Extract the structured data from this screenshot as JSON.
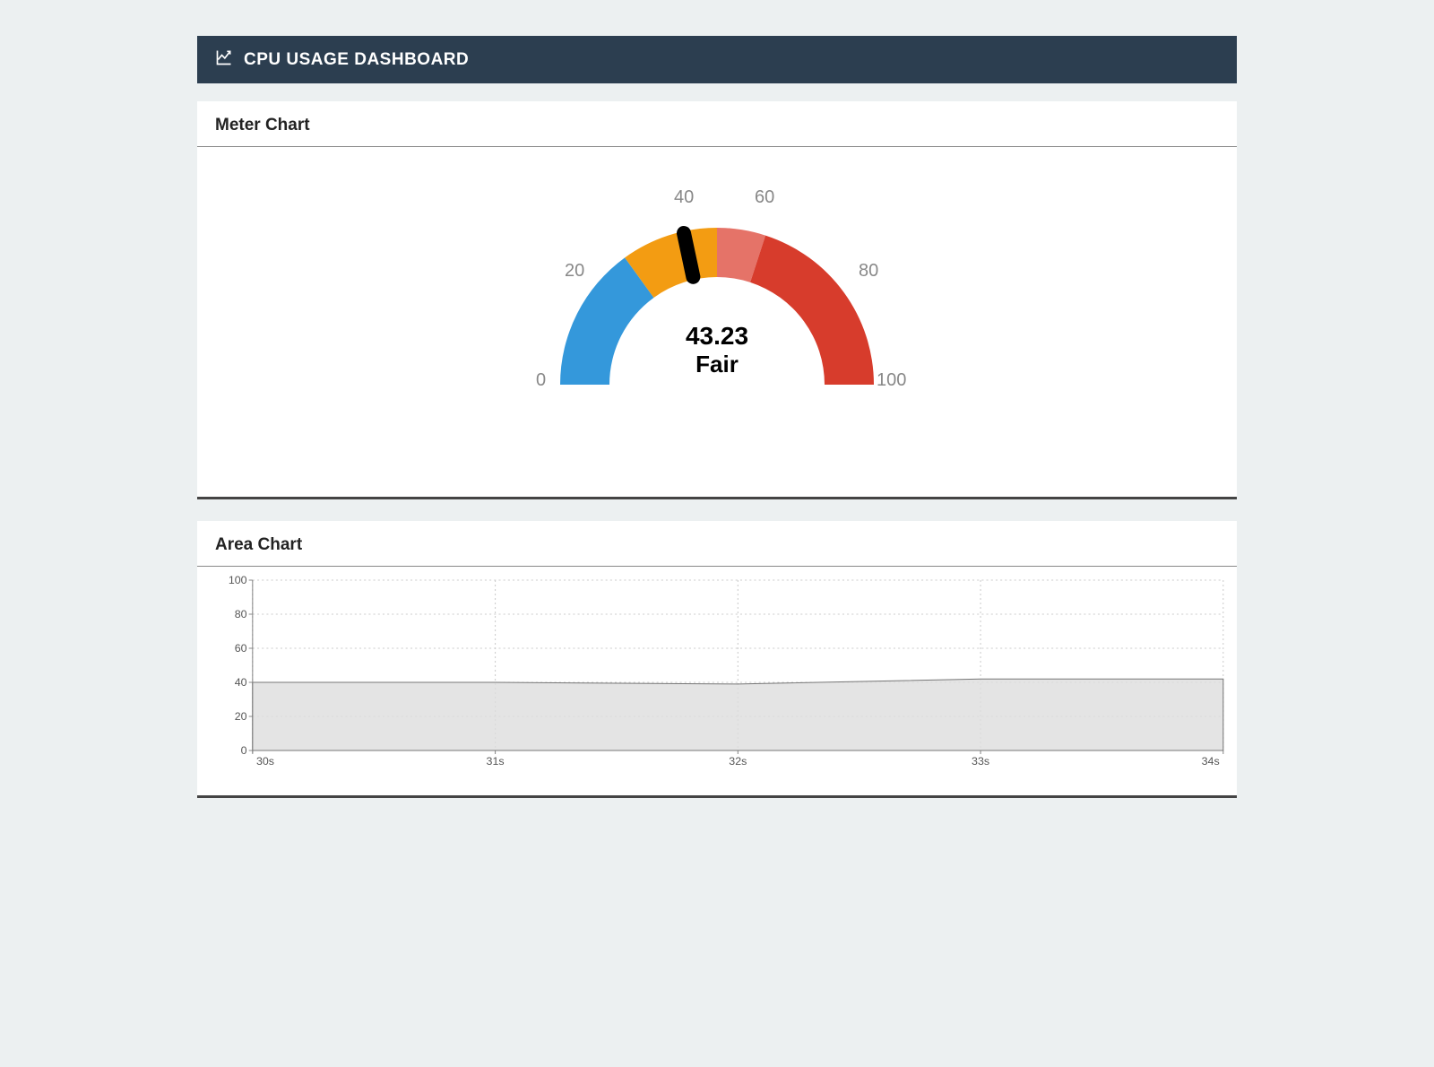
{
  "header": {
    "title": "CPU USAGE DASHBOARD"
  },
  "meter_panel": {
    "title": "Meter Chart",
    "value_text": "43.23",
    "status_text": "Fair",
    "ticks": {
      "t0": "0",
      "t20": "20",
      "t40": "40",
      "t60": "60",
      "t80": "80",
      "t100": "100"
    }
  },
  "area_panel": {
    "title": "Area Chart",
    "yticks": {
      "y0": "0",
      "y20": "20",
      "y40": "40",
      "y60": "60",
      "y80": "80",
      "y100": "100"
    },
    "xticks": {
      "x0": "30s",
      "x1": "31s",
      "x2": "32s",
      "x3": "33s",
      "x4": "34s"
    }
  },
  "chart_data": [
    {
      "type": "gauge",
      "title": "Meter Chart",
      "value": 43.23,
      "status": "Fair",
      "min": 0,
      "max": 100,
      "segments": [
        {
          "from": 0,
          "to": 30,
          "color": "#3498db"
        },
        {
          "from": 30,
          "to": 50,
          "color": "#f39c12"
        },
        {
          "from": 50,
          "to": 60,
          "color": "#e74c3c"
        },
        {
          "from": 60,
          "to": 100,
          "color": "#d73c2c"
        }
      ],
      "ticks": [
        0,
        20,
        40,
        60,
        80,
        100
      ]
    },
    {
      "type": "area",
      "title": "Area Chart",
      "xlabel": "",
      "ylabel": "",
      "ylim": [
        0,
        100
      ],
      "categories": [
        "30s",
        "31s",
        "32s",
        "33s",
        "34s"
      ],
      "values": [
        40,
        40,
        39,
        42,
        42
      ]
    }
  ]
}
